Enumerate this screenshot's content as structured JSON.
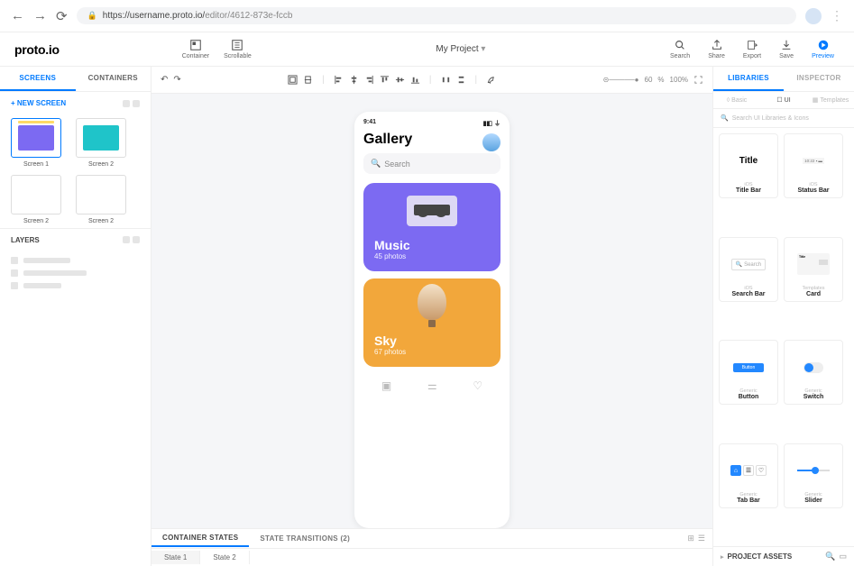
{
  "browser": {
    "url_prefix": "https://username.proto.io/",
    "url_suffix": "editor/4612-873e-fccb"
  },
  "logo": "proto.io",
  "topbar": {
    "container": "Container",
    "scrollable": "Scrollable",
    "project": "My Project",
    "search": "Search",
    "share": "Share",
    "export": "Export",
    "save": "Save",
    "preview": "Preview"
  },
  "left": {
    "tabs": {
      "screens": "SCREENS",
      "containers": "CONTAINERS"
    },
    "new_screen": "+ NEW SCREEN",
    "thumbs": [
      "Screen 1",
      "Screen 2",
      "Screen 2",
      "Screen 2"
    ],
    "layers": "LAYERS"
  },
  "zoom": {
    "value": "60",
    "pct": "%",
    "hundred": "100%"
  },
  "phone": {
    "time": "9:41",
    "title": "Gallery",
    "search": "Search",
    "cards": [
      {
        "title": "Music",
        "subtitle": "45 photos"
      },
      {
        "title": "Sky",
        "subtitle": "67 photos"
      }
    ]
  },
  "bottom": {
    "container_states": "CONTAINER STATES",
    "state_transitions": "STATE TRANSITIONS (2)",
    "state1": "State 1",
    "state2": "State 2"
  },
  "right": {
    "tabs": {
      "libraries": "LIBRARIES",
      "inspector": "INSPECTOR"
    },
    "subtabs": {
      "basic": "Basic",
      "ui": "UI",
      "templates": "Templates"
    },
    "search": "Search UI Libraries & Icons",
    "items": [
      {
        "cat": "iOS",
        "name": "Title Bar",
        "preview": "Title"
      },
      {
        "cat": "iOS",
        "name": "Status Bar",
        "preview": "10:22 ▪ ▬"
      },
      {
        "cat": "iOS",
        "name": "Search Bar",
        "preview": "Search"
      },
      {
        "cat": "Templates",
        "name": "Card",
        "preview": "Title"
      },
      {
        "cat": "Generic",
        "name": "Button",
        "preview": "Button"
      },
      {
        "cat": "Generic",
        "name": "Switch",
        "preview": ""
      },
      {
        "cat": "Generic",
        "name": "Tab Bar",
        "preview": ""
      },
      {
        "cat": "Generic",
        "name": "Slider",
        "preview": ""
      }
    ],
    "assets": "PROJECT ASSETS"
  }
}
